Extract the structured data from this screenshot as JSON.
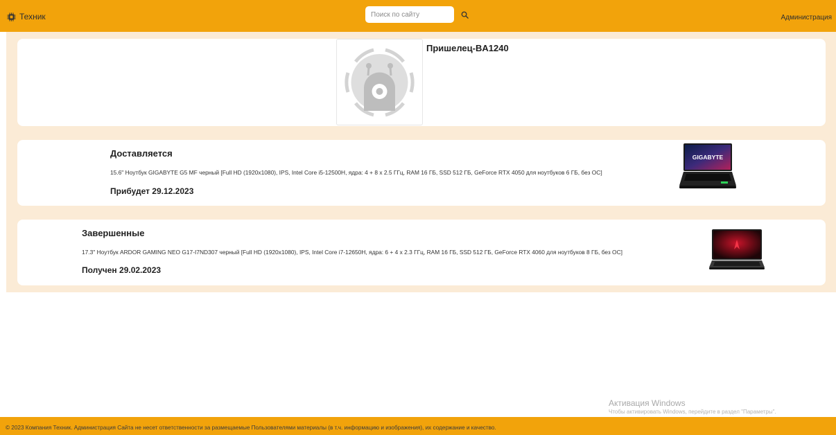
{
  "header": {
    "brand_label": "Техник",
    "brand_icon": "chip-icon",
    "search_placeholder": "Поиск по сайту",
    "search_icon": "search-icon",
    "admin_label": "Администрация",
    "accent_color": "#f2a30b"
  },
  "profile": {
    "username": "Пришелец-BA1240",
    "avatar_icon": "alien-avatar-icon"
  },
  "orders": [
    {
      "status": "Доставляется",
      "description": "15.6\" Ноутбук GIGABYTE G5 MF черный [Full HD (1920x1080), IPS, Intel Core i5-12500H, ядра: 4 + 8 x 2.5 ГГц, RAM 16 ГБ, SSD 512 ГБ, GeForce RTX 4050 для ноутбуков 6 ГБ, без ОС]",
      "date_text": "Прибудет 29.12.2023",
      "image_icon": "laptop-gigabyte-image",
      "logo_text": "GIGABYTE"
    },
    {
      "status": "Завершенные",
      "description": "17.3\" Ноутбук ARDOR GAMING NEO G17-I7ND307 черный [Full HD (1920x1080), IPS, Intel Core i7-12650H, ядра: 6 + 4 x 2.3 ГГц, RAM 16 ГБ, SSD 512 ГБ, GeForce RTX 4060 для ноутбуков 8 ГБ, без ОС]",
      "date_text": "Получен 29.02.2023",
      "image_icon": "laptop-ardor-image"
    }
  ],
  "watermark": {
    "title": "Активация Windows",
    "subtitle": "Чтобы активировать Windows, перейдите в раздел \"Параметры\"."
  },
  "footer": {
    "text": "© 2023 Компания Техник. Администрация Сайта не несет ответственности за размещаемые Пользователями материалы (в т.ч. информацию и изображения), их содержание и качество."
  }
}
